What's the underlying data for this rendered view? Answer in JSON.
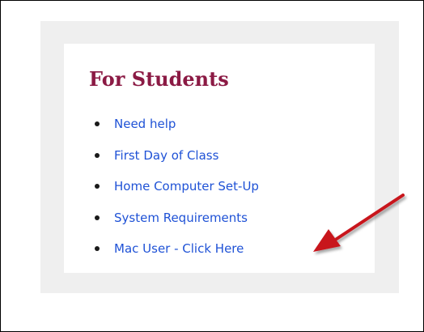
{
  "panel": {
    "title": "For Students",
    "links": [
      {
        "label": "Need help"
      },
      {
        "label": "First Day of Class"
      },
      {
        "label": "Home Computer Set-Up"
      },
      {
        "label": "System Requirements"
      },
      {
        "label": "Mac User - Click Here"
      }
    ]
  },
  "annotation": {
    "icon": "red-arrow-icon",
    "color": "#c8141e",
    "points_to": "Mac User - Click Here"
  },
  "colors": {
    "title": "#8b1a44",
    "link": "#1f52d6",
    "panel_background": "#efefef",
    "card_background": "#ffffff"
  }
}
